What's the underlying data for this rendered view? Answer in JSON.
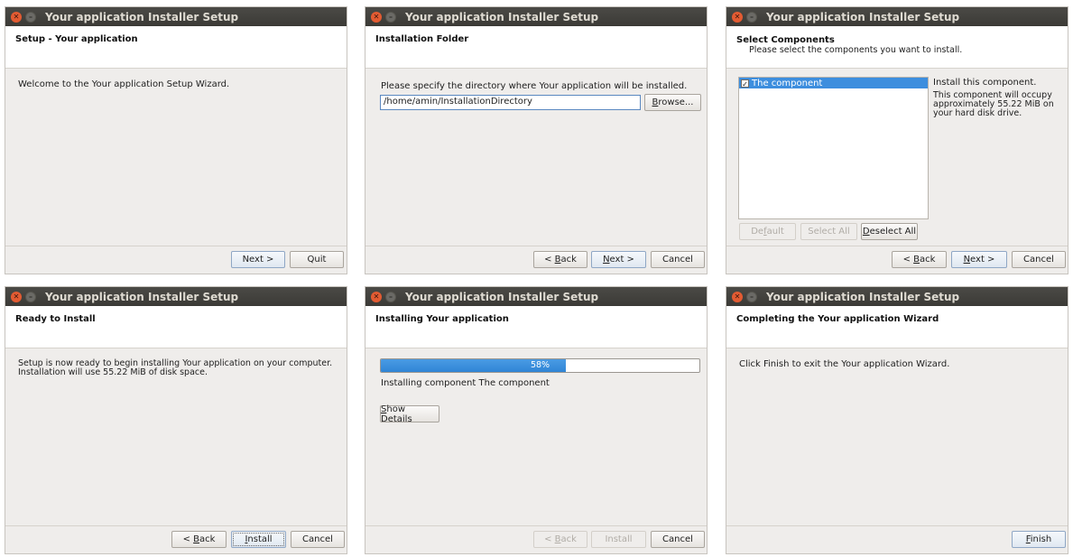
{
  "windows": {
    "w1": {
      "title": "Your application Installer Setup",
      "header_title": "Setup - Your application",
      "body_text": "Welcome to the Your application Setup Wizard.",
      "buttons": {
        "next": "Next >",
        "quit": "Quit"
      }
    },
    "w2": {
      "title": "Your application Installer Setup",
      "header_title": "Installation Folder",
      "body_text": "Please specify the directory where Your application will be installed.",
      "path_value": "/home/amin/InstallationDirectory",
      "buttons": {
        "browse": "Browse...",
        "back": "< Back",
        "next": "Next >",
        "cancel": "Cancel"
      }
    },
    "w3": {
      "title": "Your application Installer Setup",
      "header_title": "Select Components",
      "header_subtitle": "Please select the components you want to install.",
      "component_label": "The component",
      "component_checked": true,
      "desc_title": "Install this component.",
      "desc_body": "This component will occupy\napproximately 55.22 MiB on\nyour hard disk drive.",
      "buttons": {
        "default": "Default",
        "select_all": "Select All",
        "deselect_all": "Deselect All",
        "back": "< Back",
        "next": "Next >",
        "cancel": "Cancel"
      }
    },
    "w4": {
      "title": "Your application Installer Setup",
      "header_title": "Ready to Install",
      "body_text": "Setup is now ready to begin installing Your application on your computer.\nInstallation will use 55.22 MiB of disk space.",
      "buttons": {
        "back": "< Back",
        "install": "Install",
        "cancel": "Cancel"
      }
    },
    "w5": {
      "title": "Your application Installer Setup",
      "header_title": "Installing Your application",
      "progress_percent": 58,
      "progress_label": "58%",
      "status_text": "Installing component The component",
      "buttons": {
        "show_details": "Show Details",
        "back": "< Back",
        "install": "Install",
        "cancel": "Cancel"
      }
    },
    "w6": {
      "title": "Your application Installer Setup",
      "header_title": "Completing the Your application Wizard",
      "body_text": "Click Finish to exit the Your application Wizard.",
      "buttons": {
        "finish": "Finish"
      }
    }
  },
  "colors": {
    "titlebar": "#3b3a36",
    "close": "#e35b32",
    "selection": "#3d8ede",
    "progress": "#3a8fdd"
  },
  "icons": {
    "close": "close-icon",
    "minimize": "minimize-icon"
  }
}
